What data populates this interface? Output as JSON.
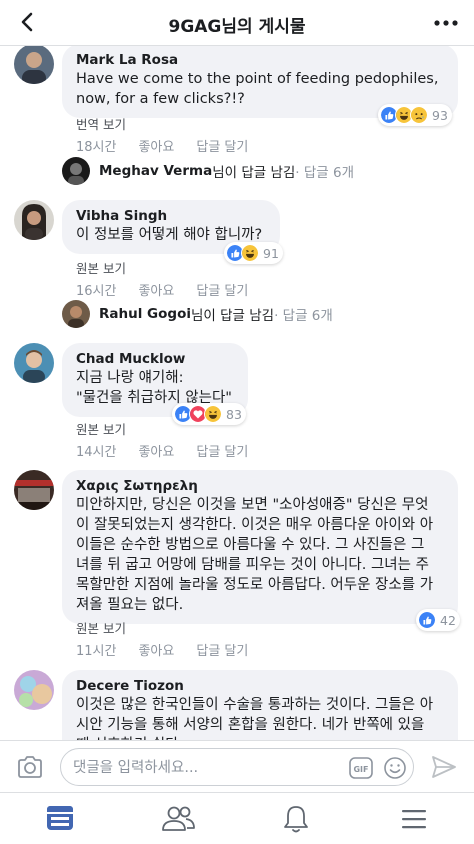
{
  "header": {
    "title": "9GAG님의 게시물",
    "back_icon": "chevron-left-icon",
    "more_icon": "more-dots-icon"
  },
  "comments": [
    {
      "name": "Mark La Rosa",
      "text": "Have we come to the point of feeding pedophiles,\nnow, for a few clicks?!?",
      "sub_link": "번역 보기",
      "time": "18시간",
      "like": "좋아요",
      "reply": "답글 달기",
      "reactions": [
        "like",
        "haha",
        "sad"
      ],
      "reaction_count": "93",
      "reply_summary": {
        "name": "Meghav Verma",
        "suffix": "님이 답글 남김",
        "count": " · 답글 6개"
      }
    },
    {
      "name": "Vibha Singh",
      "text": "이 정보를 어떻게 해야 합니까?",
      "sub_link": "원본 보기",
      "time": "16시간",
      "like": "좋아요",
      "reply": "답글 달기",
      "reactions": [
        "like",
        "haha"
      ],
      "reaction_count": "91",
      "reply_summary": {
        "name": "Rahul Gogoi",
        "suffix": "님이 답글 남김",
        "count": " · 답글 6개"
      }
    },
    {
      "name": "Chad Mucklow",
      "text": "지금 나랑 얘기해:\n\"물건을 취급하지 않는다\"",
      "sub_link": "원본 보기",
      "time": "14시간",
      "like": "좋아요",
      "reply": "답글 달기",
      "reactions": [
        "like",
        "love",
        "haha"
      ],
      "reaction_count": "83"
    },
    {
      "name": "Χαρις Σωτηρελη",
      "text": "미안하지만, 당신은 이것을 보면 \"소아성애증\" 당신은 무엇\n이 잘못되었는지 생각한다. 이것은 매우 아름다운 아이와 아\n이들은 순수한 방법으로 아름다울 수 있다. 그 사진들은 그\n녀를 뒤 굽고 어망에 담배를 피우는 것이 아니다. 그녀는 주\n목할만한 지점에 놀라울 정도로 아름답다. 어두운 장소를 가\n져올 필요는 없다.",
      "sub_link": "원본 보기",
      "time": "11시간",
      "like": "좋아요",
      "reply": "답글 달기",
      "reactions": [
        "like"
      ],
      "reaction_count": "42"
    },
    {
      "name": "Decere Tiozon",
      "text": "이것은 많은 한국인들이 수술을 통과하는 것이다. 그들은 아\n시안 기능을 통해 서양의 혼합을 원한다. 네가 반쪽에 있을\n때 선호하기 쉽다."
    }
  ],
  "composer": {
    "placeholder": "댓글을 입력하세요...",
    "value": "",
    "camera_icon": "camera-icon",
    "gif_label": "GIF",
    "emoji_icon": "emoji-icon",
    "send_icon": "send-icon"
  },
  "tabbar": {
    "items": [
      "news-feed-icon",
      "friends-icon",
      "notifications-bell-icon",
      "menu-icon"
    ],
    "active": "news-feed-icon"
  },
  "colors": {
    "bubble_bg": "#f1f2f6",
    "accent_blue": "#4267b2",
    "meta_gray": "#8d949e",
    "like_blue": "#3b82f6",
    "love_red": "#f0425c",
    "haha_yellow": "#f7c43a"
  }
}
